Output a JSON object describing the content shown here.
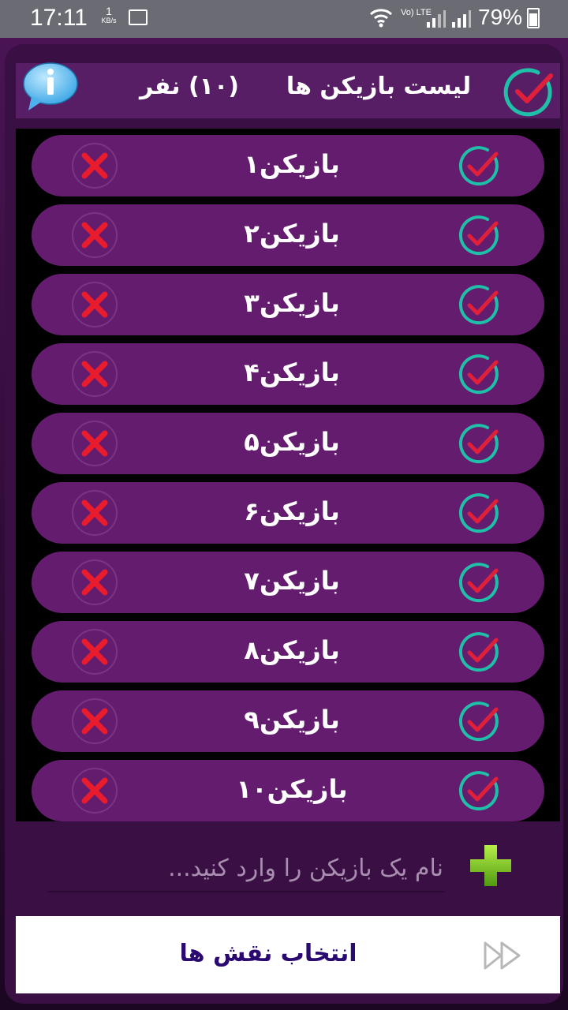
{
  "status_bar": {
    "time": "17:11",
    "speed_value": "1",
    "speed_unit": "KB/s",
    "network": "Vo) LTE",
    "battery": "79%"
  },
  "header": {
    "title": "لیست بازیکن ها",
    "count": "(۱۰) نفر",
    "icons": {
      "select_all": "check-circle-icon",
      "info": "info-bubble-icon"
    }
  },
  "players": [
    {
      "name": "بازیکن۱"
    },
    {
      "name": "بازیکن۲"
    },
    {
      "name": "بازیکن۳"
    },
    {
      "name": "بازیکن۴"
    },
    {
      "name": "بازیکن۵"
    },
    {
      "name": "بازیکن۶"
    },
    {
      "name": "بازیکن۷"
    },
    {
      "name": "بازیکن۸"
    },
    {
      "name": "بازیکن۹"
    },
    {
      "name": "بازیکن۱۰"
    }
  ],
  "add_player": {
    "placeholder": "نام یک بازیکن را وارد کنید...",
    "value": "",
    "icon": "plus-icon"
  },
  "footer": {
    "button_label": "انتخاب نقش ها",
    "icon": "fast-forward-icon"
  },
  "colors": {
    "accent_check": "#e0203a",
    "accent_ring": "#1fbfa8",
    "row_bg": "#641c6e",
    "footer_text": "#2a0a70"
  }
}
